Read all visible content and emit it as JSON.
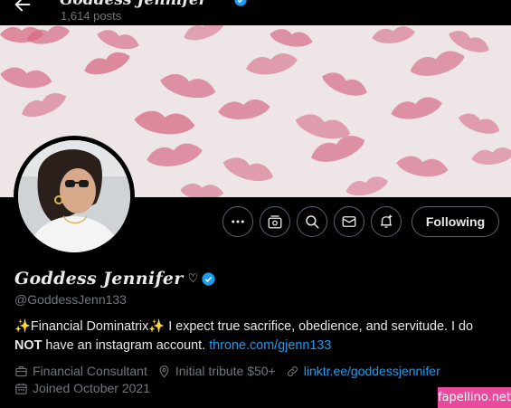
{
  "header": {
    "name": "Goddess Jennifer",
    "post_count": "1,614 posts"
  },
  "actions": {
    "follow_label": "Following"
  },
  "profile": {
    "display_name": "Goddess Jennifer",
    "name_suffix": "♡",
    "handle": "@GoddessJenn133",
    "bio_part1": "Financial Dominatrix",
    "bio_part2": " I expect true sacrifice, obedience, and servitude. I do ",
    "bio_bold": "NOT",
    "bio_part3": " have an instagram account. ",
    "bio_link": "throne.com/gjenn133",
    "sparkle": "✨"
  },
  "meta": {
    "category": "Financial Consultant",
    "location": "Initial tribute $50+",
    "website": "linktr.ee/goddessjennifer",
    "joined": "Joined October 2021"
  },
  "watermark": "fapellino.net",
  "colors": {
    "background": "#000000",
    "text": "#e7e9ea",
    "muted": "#71767b",
    "link": "#1d9bf0",
    "verified": "#1d9bf0",
    "watermark": "#e94a9e"
  }
}
